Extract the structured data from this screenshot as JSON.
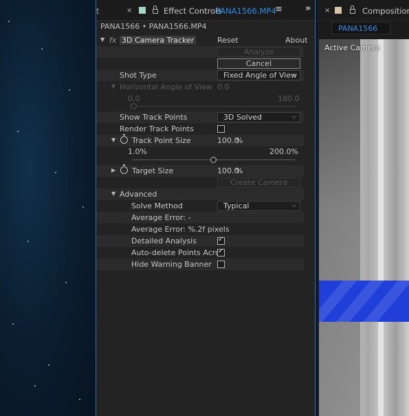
{
  "effect_tab": {
    "title": "Effect Controls",
    "file": "PANA1566.MP4",
    "partial_tab": "t"
  },
  "layer_path": "PANA1566 • PANA1566.MP4",
  "effect": {
    "name": "3D Camera Tracker",
    "fx": "fx",
    "reset": "Reset",
    "about": "About"
  },
  "buttons": {
    "analyze": "Analyze",
    "cancel": "Cancel",
    "create_camera": "Create Camera"
  },
  "shot_type": {
    "label": "Shot Type",
    "value": "Fixed Angle of View"
  },
  "h_angle": {
    "label": "Horizontal Angle of View",
    "value": "0.0",
    "min": "0.0",
    "max": "180.0"
  },
  "show_track_points": {
    "label": "Show Track Points",
    "value": "3D Solved"
  },
  "render_track_points": {
    "label": "Render Track Points",
    "checked": false
  },
  "track_point_size": {
    "label": "Track Point Size",
    "value": "100.0",
    "unit": "%",
    "min": "1.0%",
    "max": "200.0%",
    "fraction": 0.5
  },
  "target_size": {
    "label": "Target Size",
    "value": "100.0",
    "unit": "%"
  },
  "advanced": {
    "label": "Advanced",
    "solve_method": {
      "label": "Solve Method",
      "value": "Typical"
    },
    "avg_error_1": "Average Error: -",
    "avg_error_2": "Average Error: %.2f pixels",
    "detailed_analysis": {
      "label": "Detailed Analysis",
      "checked": true
    },
    "auto_delete": {
      "label": "Auto-delete Points Acro",
      "checked": true
    },
    "hide_warning": {
      "label": "Hide Warning Banner",
      "checked": false
    }
  },
  "comp_tab": {
    "title": "Composition",
    "comp_name": "PANA1566",
    "viewer_label": "Active Camera"
  },
  "colors": {
    "accent": "#2f8ce0",
    "panel_bg": "#232323",
    "blue_bar": "#1f3fd8"
  }
}
